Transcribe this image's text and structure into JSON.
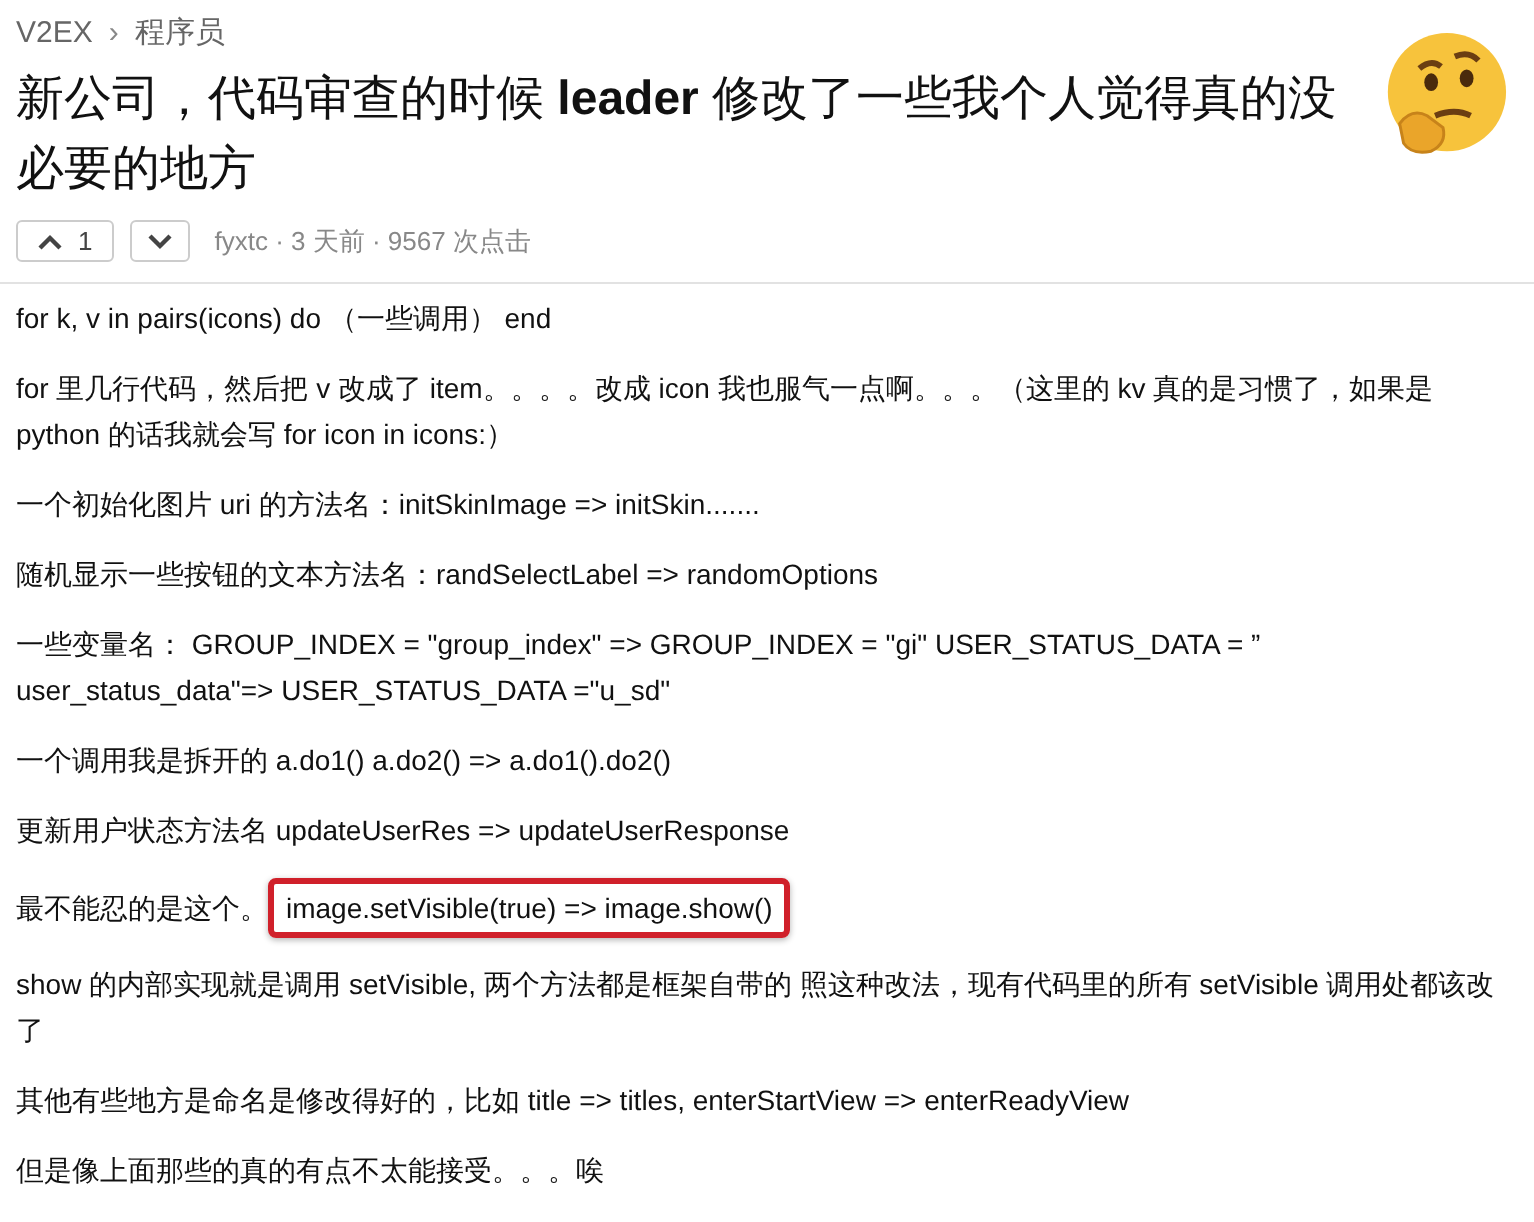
{
  "breadcrumb": {
    "site": "V2EX",
    "separator": "›",
    "node": "程序员"
  },
  "title": "新公司，代码审查的时候 **leader** 修改了一些我个人觉得真的没必要的地方",
  "votes": {
    "up_count": "1"
  },
  "meta": "fyxtc · 3 天前 · 9567 次点击",
  "paragraphs": [
    {
      "text": "for k, v in pairs(icons) do （一些调用） end"
    },
    {
      "text": "for 里几行代码，然后把 v 改成了 item。。。。改成 icon 我也服气一点啊。。。（这里的 kv 真的是习惯了，如果是 python 的话我就会写 for icon in icons:）"
    },
    {
      "text": "一个初始化图片 uri 的方法名：initSkinImage => initSkin......."
    },
    {
      "text": "随机显示一些按钮的文本方法名：randSelectLabel => randomOptions"
    },
    {
      "text": "一些变量名： GROUP_INDEX = \"group_index\" => GROUP_INDEX = \"gi\" USER_STATUS_DATA = ” user_status_data\"=> USER_STATUS_DATA =\"u_sd\""
    },
    {
      "text": "一个调用我是拆开的 a.do1() a.do2() => a.do1().do2()"
    },
    {
      "text": "更新用户状态方法名 updateUserRes => updateUserResponse"
    },
    {
      "text": "最不能忍的是这个。",
      "highlight": "image.setVisible(true) => image.show()"
    },
    {
      "text": "show 的内部实现就是调用 setVisible, 两个方法都是框架自带的 照这种改法，现有代码里的所有 setVisible 调用处都该改了"
    },
    {
      "text": "其他有些地方是命名是修改得好的，比如 title => titles, enterStartView => enterReadyView"
    },
    {
      "text": "但是像上面那些的真的有点不太能接受。。。唉"
    }
  ]
}
